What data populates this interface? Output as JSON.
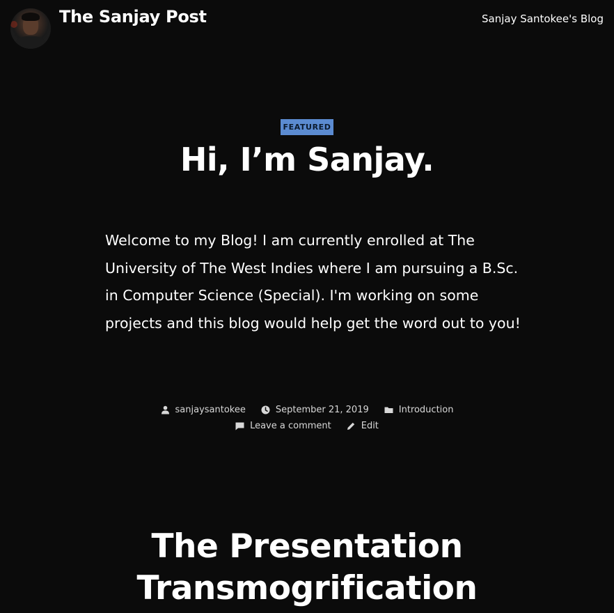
{
  "header": {
    "site_title": "The Sanjay Post",
    "tagline": "Sanjay Santokee's Blog"
  },
  "post": {
    "badge": "FEATURED",
    "title": "Hi, I’m Sanjay.",
    "body": "Welcome to my Blog! I am currently enrolled at The University of The West Indies where I am pursuing a B.Sc. in Computer Science (Special). I'm working on some projects and this blog would help get the word out to you!",
    "meta": {
      "author": "sanjaysantokee",
      "date": "September 21, 2019",
      "category": "Introduction",
      "comment_link": "Leave a comment",
      "edit_link": "Edit"
    }
  },
  "next_post": {
    "title": "The Presentation Transmogrification"
  },
  "colors": {
    "background": "#0b0b0b",
    "badge": "#5b8bd1",
    "text": "#ffffff",
    "meta_text": "#d8d8d8"
  },
  "icons": {
    "author": "user-icon",
    "date": "clock-icon",
    "category": "folder-icon",
    "comment": "comment-icon",
    "edit": "pencil-icon"
  }
}
